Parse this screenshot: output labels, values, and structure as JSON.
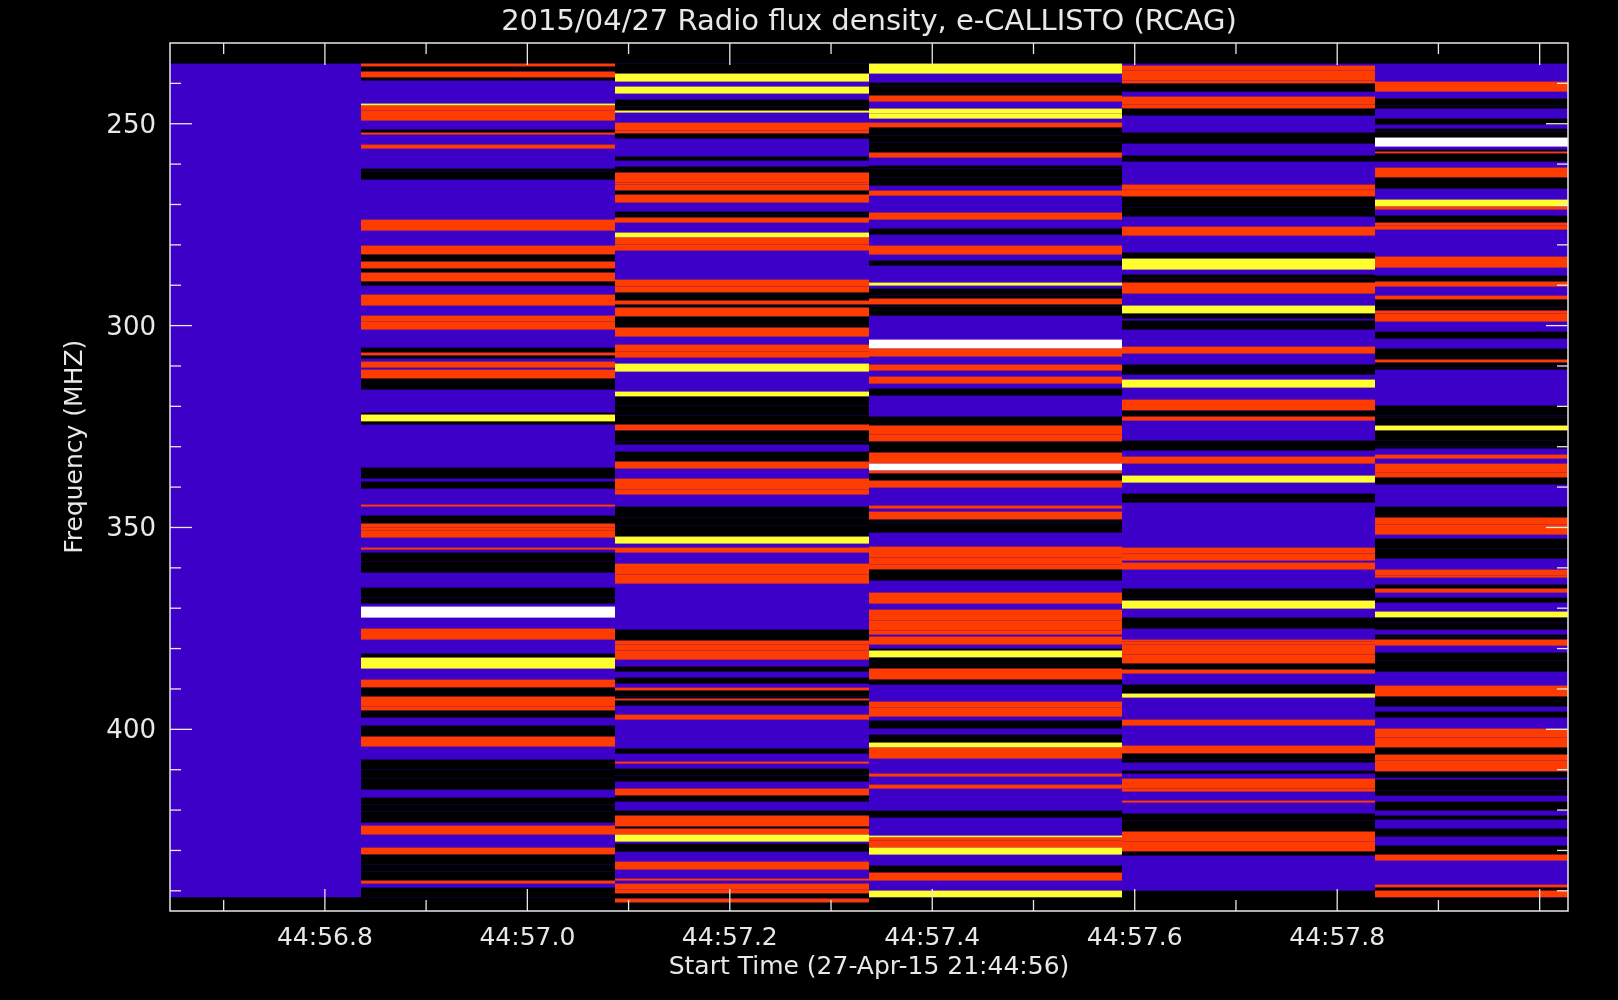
{
  "title": "2015/04/27  Radio flux density, e-CALLISTO (RCAG)",
  "plot": {
    "ylabel": "Frequency (MHZ)",
    "xlabel": "Start Time (27-Apr-15 21:44:56)",
    "yticks": [
      "250",
      "300",
      "350",
      "400"
    ],
    "xticks": [
      "44:56.8",
      "44:57.0",
      "44:57.2",
      "44:57.4",
      "44:57.6",
      "44:57.8"
    ]
  }
}
